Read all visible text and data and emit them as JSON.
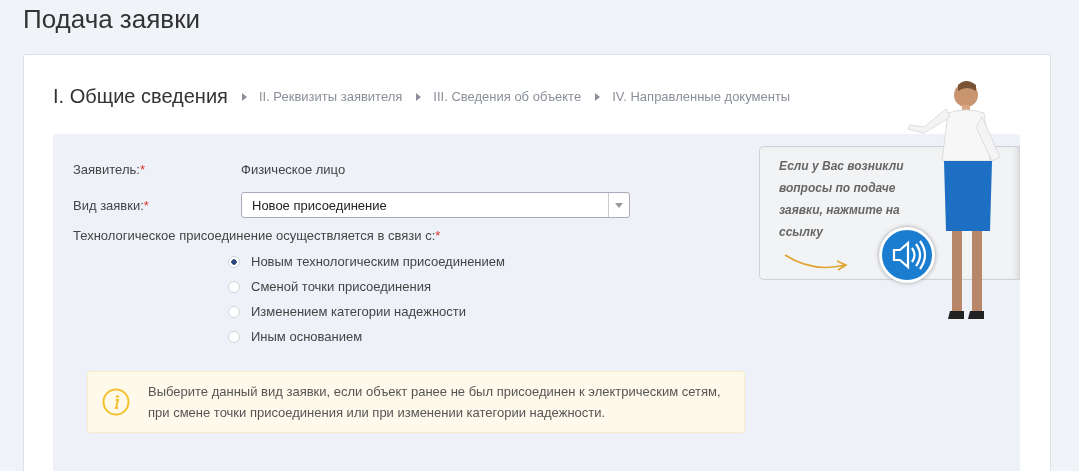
{
  "page_title": "Подача заявки",
  "steps": [
    {
      "label": "I. Общие сведения",
      "selected": true
    },
    {
      "label": "II. Реквизиты заявителя",
      "selected": false
    },
    {
      "label": "III. Сведения об объекте",
      "selected": false
    },
    {
      "label": "IV. Направленные документы",
      "selected": false
    }
  ],
  "fields": [
    {
      "kind": "text",
      "label": "Заявитель:",
      "required_mark": "*",
      "value": "Физическое лицо"
    },
    {
      "kind": "select",
      "label": "Вид заявки:",
      "required_mark": "*",
      "value": "Новое присоединение"
    }
  ],
  "reason": {
    "label": "Технологическое присоединение осуществляется в связи с:",
    "required_mark": "*",
    "options": [
      {
        "label": "Новым технологическим присоединением",
        "selected": true
      },
      {
        "label": "Сменой точки присоединения",
        "selected": false
      },
      {
        "label": "Изменением категории надежности",
        "selected": false
      },
      {
        "label": "Иным основанием",
        "selected": false
      }
    ]
  },
  "notice": {
    "text": "Выберите данный вид заявки, если объект ранее не был присоединен к электрическим сетям, при смене точки присоединения или при изменении категории надежности."
  },
  "help": {
    "text": "Если у Вас возникли вопросы по подаче заявки, нажмите на ссылку"
  }
}
